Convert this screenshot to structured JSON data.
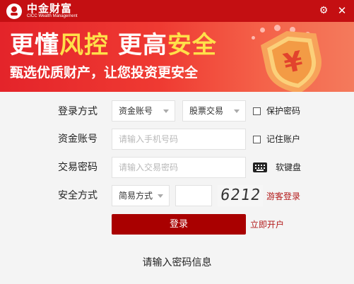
{
  "titlebar": {
    "brand_cn": "中金财富",
    "brand_en": "CICC Wealth Management",
    "settings_icon": "gear-icon",
    "close_icon": "close-icon",
    "color": "#c40f12"
  },
  "banner": {
    "headline_part1": "更懂",
    "headline_part2": "风控",
    "headline_part3": " 更高",
    "headline_part4": "安全",
    "subline": "甄选优质财产，让您投资更安全",
    "shield_symbol": "¥"
  },
  "form": {
    "login_method": {
      "label": "登录方式",
      "account_type": "资金账号",
      "trade_type": "股票交易"
    },
    "protect_password": {
      "label": "保护密码",
      "checked": false
    },
    "account": {
      "label": "资金账号",
      "placeholder": "请输入手机号码"
    },
    "remember_account": {
      "label": "记住账户",
      "checked": false
    },
    "password": {
      "label": "交易密码",
      "placeholder": "请输入交易密码"
    },
    "soft_keyboard": {
      "label": "软键盘",
      "icon": "keyboard-icon"
    },
    "security": {
      "label": "安全方式",
      "mode": "简易方式",
      "captcha_input": "",
      "captcha_text": "6212"
    },
    "guest_login": "游客登录",
    "login_button": "登录",
    "open_account": "立即开户"
  },
  "status_message": "请输入密码信息",
  "colors": {
    "brand_red": "#c40f12",
    "button_red": "#a90000",
    "link_red": "#b31b1b",
    "highlight_yellow": "#ffe04a"
  }
}
